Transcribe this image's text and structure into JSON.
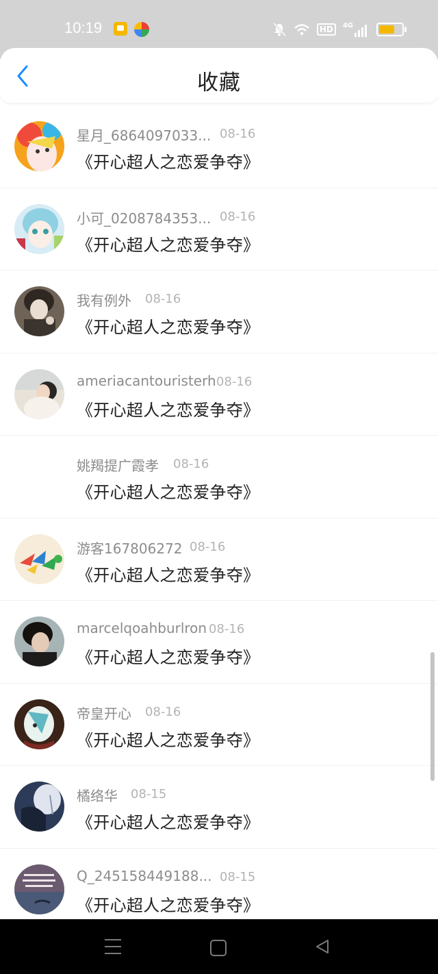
{
  "status_bar": {
    "time": "10:19",
    "icons": [
      "app-notification-icon",
      "app-colorful-icon",
      "mute-icon",
      "wifi-icon",
      "hd-icon",
      "signal-4g-icon",
      "battery-icon"
    ],
    "hd_label": "HD",
    "network_label": "4G"
  },
  "header": {
    "title": "收藏",
    "back_icon": "chevron-left-icon",
    "accent_color": "#1a8cff"
  },
  "favorites": [
    {
      "username": "星月_6864097033...",
      "date": "08-16",
      "title": "《开心超人之恋爱争夺》"
    },
    {
      "username": "小可_0208784353...",
      "date": "08-16",
      "title": "《开心超人之恋爱争夺》"
    },
    {
      "username": "我有例外",
      "date": "08-16",
      "title": "《开心超人之恋爱争夺》"
    },
    {
      "username": "ameriacantouristerh",
      "date": "08-16",
      "title": "《开心超人之恋爱争夺》"
    },
    {
      "username": "姚羯提广霞孝",
      "date": "08-16",
      "title": "《开心超人之恋爱争夺》"
    },
    {
      "username": "游客167806272",
      "date": "08-16",
      "title": "《开心超人之恋爱争夺》"
    },
    {
      "username": "marcelqoahburlron",
      "date": "08-16",
      "title": "《开心超人之恋爱争夺》"
    },
    {
      "username": "帝皇开心",
      "date": "08-16",
      "title": "《开心超人之恋爱争夺》"
    },
    {
      "username": "橘络华",
      "date": "08-15",
      "title": "《开心超人之恋爱争夺》"
    },
    {
      "username": "Q_245158449188...",
      "date": "08-15",
      "title": "《开心超人之恋爱争夺》"
    }
  ],
  "nav_bar": {
    "icons": [
      "menu-icon",
      "home-icon",
      "back-triangle-icon"
    ]
  }
}
